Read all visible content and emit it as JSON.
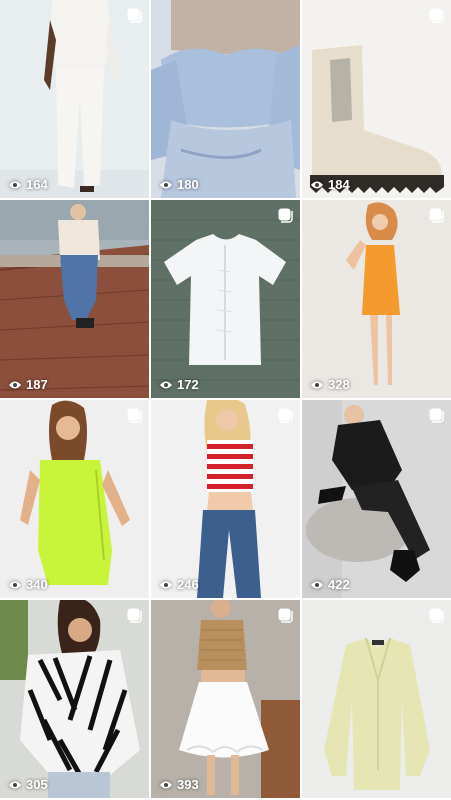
{
  "grid": {
    "tiles": [
      {
        "subject": "white-pantsuit",
        "views": "164",
        "bg": "#e9eef0"
      },
      {
        "subject": "blue-corset-top",
        "views": "180",
        "bg": "#c9d6e6"
      },
      {
        "subject": "cream-chelsea-boot",
        "views": "184",
        "bg": "#f2efe9"
      },
      {
        "subject": "woman-on-brick-wall",
        "views": "187",
        "bg": "#8f9aa3"
      },
      {
        "subject": "white-ruched-tee",
        "views": "172",
        "bg": "#5c6e64"
      },
      {
        "subject": "orange-mini-dress",
        "views": "328",
        "bg": "#eae7e3"
      },
      {
        "subject": "lime-ruched-dress",
        "views": "340",
        "bg": "#eeeeee"
      },
      {
        "subject": "red-striped-crop-top",
        "views": "246",
        "bg": "#f1f1f1"
      },
      {
        "subject": "black-satin-set",
        "views": "422",
        "bg": "#dcdcdc"
      },
      {
        "subject": "zebra-print-shirt",
        "views": "305",
        "bg": "#d7d9d4"
      },
      {
        "subject": "knit-top-white-skirt",
        "views": "393",
        "bg": "#b9b3ab"
      },
      {
        "subject": "pale-yellow-blazer",
        "views": "",
        "bg": "#eaeae6"
      }
    ],
    "icons": {
      "multi": "multiple-images-icon",
      "views": "eye-icon"
    }
  }
}
